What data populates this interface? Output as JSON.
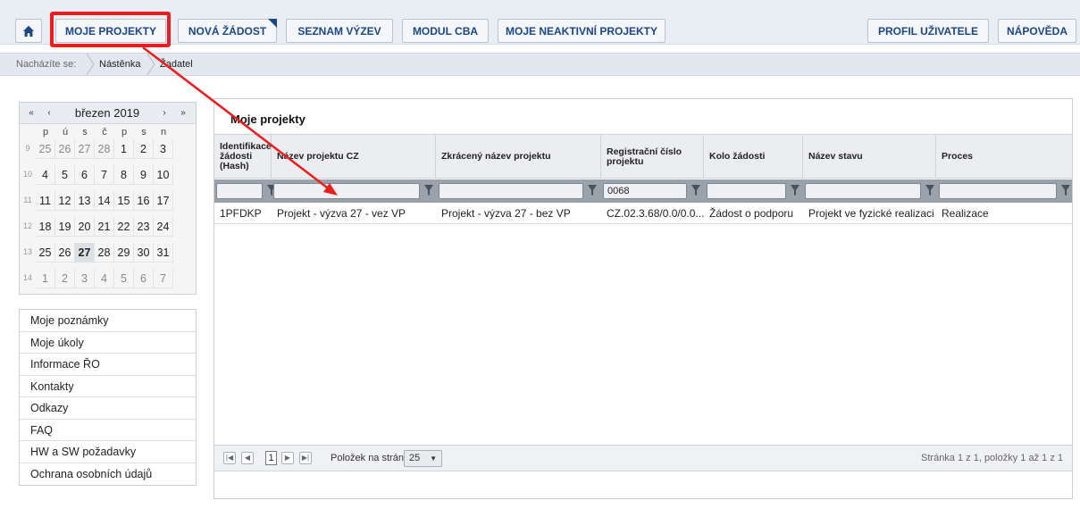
{
  "nav": {
    "home_icon": "home-icon",
    "buttons": [
      {
        "label": "MOJE PROJEKTY"
      },
      {
        "label": "NOVÁ ŽÁDOST"
      },
      {
        "label": "SEZNAM VÝZEV"
      },
      {
        "label": "MODUL CBA"
      },
      {
        "label": "MOJE NEAKTIVNÍ PROJEKTY"
      },
      {
        "label": "PROFIL UŽIVATELE"
      },
      {
        "label": "NÁPOVĚDA"
      }
    ]
  },
  "breadcrumb": {
    "prefix": "Nacházíte se:",
    "items": [
      "Nástěnka",
      "Žadatel"
    ]
  },
  "calendar": {
    "month": "březen 2019",
    "nav": [
      "«",
      "‹",
      "›",
      "»"
    ],
    "weekdays": [
      "p",
      "ú",
      "s",
      "č",
      "p",
      "s",
      "n"
    ],
    "weeks": [
      {
        "no": "9",
        "days": [
          "25",
          "26",
          "27",
          "28",
          "1",
          "2",
          "3"
        ]
      },
      {
        "no": "10",
        "days": [
          "4",
          "5",
          "6",
          "7",
          "8",
          "9",
          "10"
        ]
      },
      {
        "no": "11",
        "days": [
          "11",
          "12",
          "13",
          "14",
          "15",
          "16",
          "17"
        ]
      },
      {
        "no": "12",
        "days": [
          "18",
          "19",
          "20",
          "21",
          "22",
          "23",
          "24"
        ]
      },
      {
        "no": "13",
        "days": [
          "25",
          "26",
          "27",
          "28",
          "29",
          "30",
          "31"
        ]
      },
      {
        "no": "14",
        "days": [
          "1",
          "2",
          "3",
          "4",
          "5",
          "6",
          "7"
        ]
      }
    ],
    "today": "27"
  },
  "left_menu": [
    "Moje poznámky",
    "Moje úkoly",
    "Informace ŘO",
    "Kontakty",
    "Odkazy",
    "FAQ",
    "HW a SW požadavky",
    "Ochrana osobních údajů"
  ],
  "panel": {
    "title": "Moje projekty",
    "columns": [
      "Identifikace žádosti (Hash)",
      "Název projektu CZ",
      "Zkrácený název projektu",
      "Registrační číslo projektu",
      "Kolo žádosti",
      "Název stavu",
      "Proces"
    ],
    "filters": [
      "",
      "",
      "",
      "0068",
      "",
      "",
      ""
    ],
    "rows": [
      [
        "1PFDKP",
        "Projekt - výzva 27 - vez VP",
        "Projekt - výzva 27 - bez VP",
        "CZ.02.3.68/0.0/0.0...",
        "Žádost o podporu",
        "Projekt ve fyzické realizaci",
        "Realizace"
      ]
    ],
    "pager": {
      "current_page": "1",
      "per_page_label": "Položek na stránku",
      "per_page_value": "25",
      "info": "Stránka 1 z 1, položky 1 až 1 z 1"
    }
  },
  "colors": {
    "nav_text": "#1c4684",
    "highlight": "#ee1c1c",
    "filter_bar": "#9aa2ac"
  }
}
